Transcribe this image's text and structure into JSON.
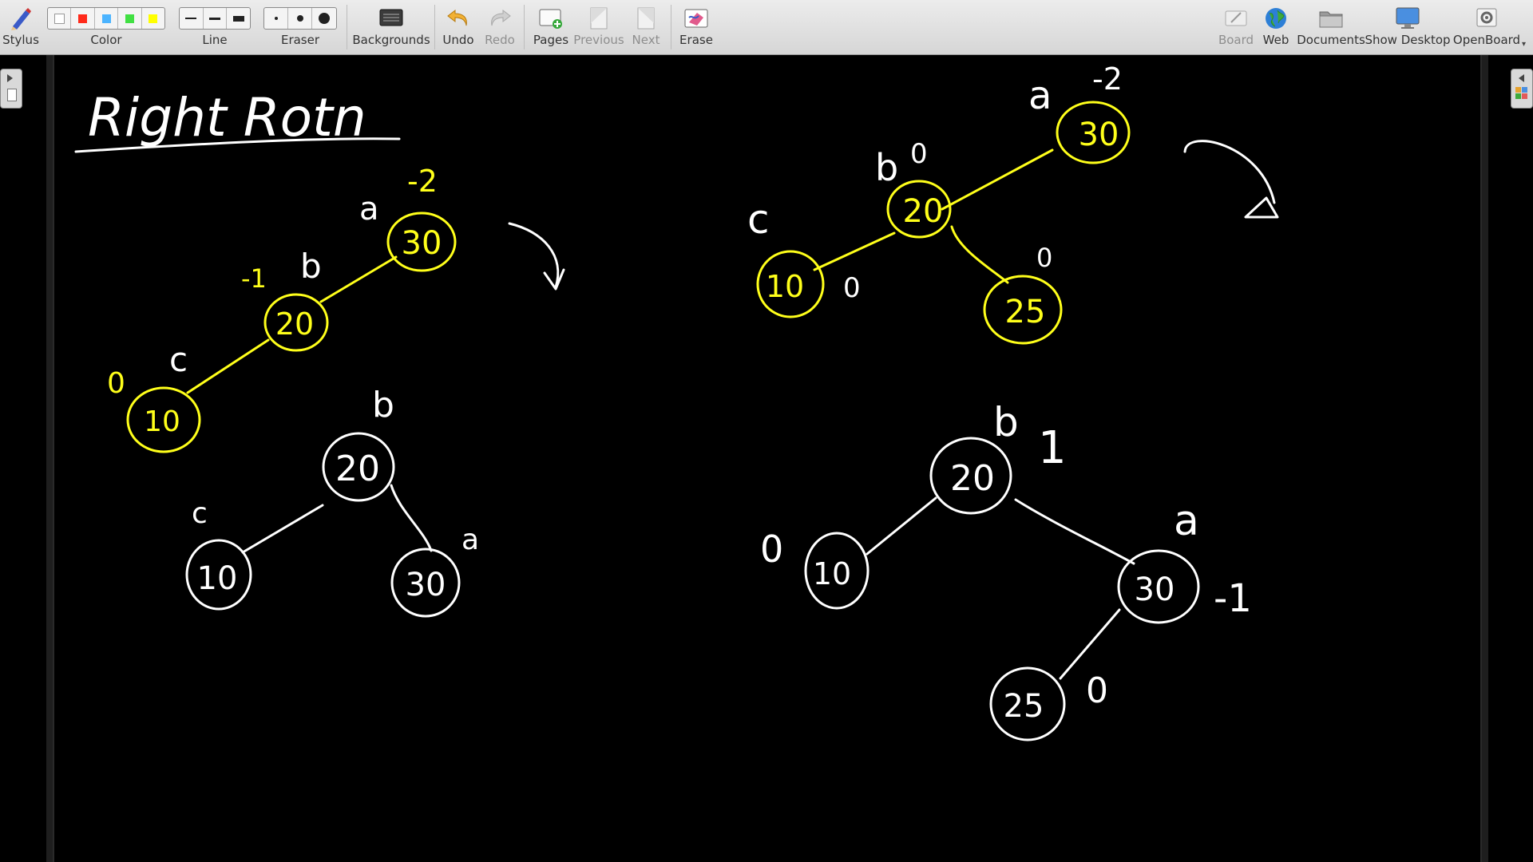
{
  "toolbar": {
    "stylus": "Stylus",
    "color": "Color",
    "line": "Line",
    "eraser": "Eraser",
    "backgrounds": "Backgrounds",
    "undo": "Undo",
    "redo": "Redo",
    "pages": "Pages",
    "previous": "Previous",
    "next": "Next",
    "erase": "Erase",
    "board": "Board",
    "web": "Web",
    "documents": "Documents",
    "show_desktop": "Show Desktop",
    "openboard": "OpenBoard"
  },
  "palette": [
    "#ffffff",
    "#ff2a1a",
    "#4cb4ff",
    "#41e043",
    "#ffff00"
  ],
  "ink": {
    "white": "#ffffff",
    "yellow": "#ffff1a"
  },
  "board": {
    "title": "Right Rotn",
    "tree1": {
      "nodes": [
        "30",
        "20",
        "10"
      ],
      "labels": [
        "a",
        "b",
        "c"
      ],
      "balance": [
        "-2",
        "-1",
        "0"
      ]
    },
    "tree2": {
      "nodes": [
        "20",
        "10",
        "30"
      ],
      "labels": [
        "b",
        "c",
        "a"
      ]
    },
    "tree3": {
      "nodes": [
        "30",
        "20",
        "10",
        "25"
      ],
      "labels": [
        "a",
        "b",
        "c"
      ],
      "balance": [
        "-2",
        "0",
        "0",
        "0"
      ]
    },
    "tree4": {
      "nodes": [
        "20",
        "10",
        "30",
        "25"
      ],
      "labels": [
        "b",
        "a"
      ],
      "balance": [
        "1",
        "0",
        "-1",
        "0"
      ]
    }
  }
}
